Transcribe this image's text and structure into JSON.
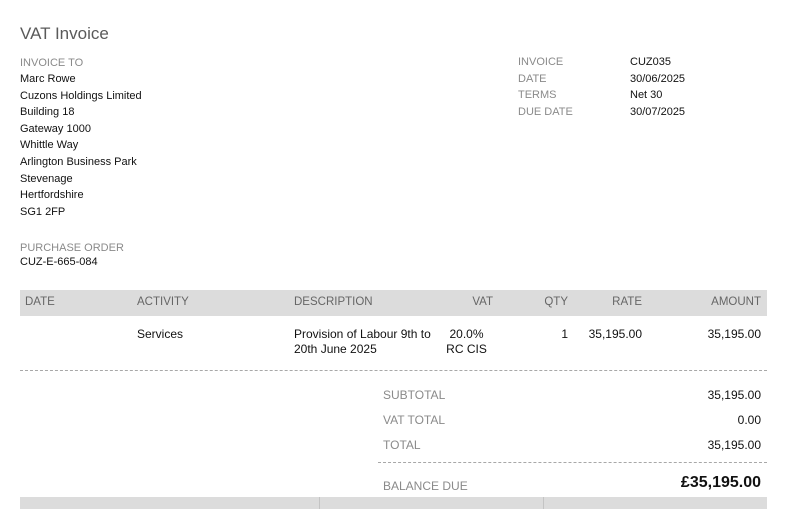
{
  "document": {
    "title": "VAT Invoice"
  },
  "invoice_to": {
    "label": "INVOICE TO",
    "lines": [
      "Marc Rowe",
      "Cuzons Holdings Limited",
      "Building 18",
      "Gateway 1000",
      "Whittle Way",
      "Arlington Business Park",
      "Stevenage",
      "Hertfordshire",
      "SG1 2FP"
    ]
  },
  "meta": [
    {
      "label": "INVOICE",
      "value": "CUZ035"
    },
    {
      "label": "DATE",
      "value": "30/06/2025"
    },
    {
      "label": "TERMS",
      "value": "Net 30"
    },
    {
      "label": "DUE DATE",
      "value": "30/07/2025"
    }
  ],
  "purchase_order": {
    "label": "PURCHASE ORDER",
    "value": "CUZ-E-665-084"
  },
  "table": {
    "headers": {
      "date": "DATE",
      "activity": "ACTIVITY",
      "description": "DESCRIPTION",
      "vat": "VAT",
      "qty": "QTY",
      "rate": "RATE",
      "amount": "AMOUNT"
    },
    "rows": [
      {
        "date": "",
        "activity": "Services",
        "description_line1": "Provision of Labour 9th to",
        "description_line2": "20th June 2025",
        "vat_line1": "20.0%",
        "vat_line2": "RC CIS",
        "qty": "1",
        "rate": "35,195.00",
        "amount": "35,195.00"
      }
    ]
  },
  "totals": {
    "subtotal_label": "SUBTOTAL",
    "subtotal_value": "35,195.00",
    "vat_total_label": "VAT TOTAL",
    "vat_total_value": "0.00",
    "total_label": "TOTAL",
    "total_value": "35,195.00",
    "balance_label": "BALANCE DUE",
    "balance_value": "£35,195.00"
  }
}
